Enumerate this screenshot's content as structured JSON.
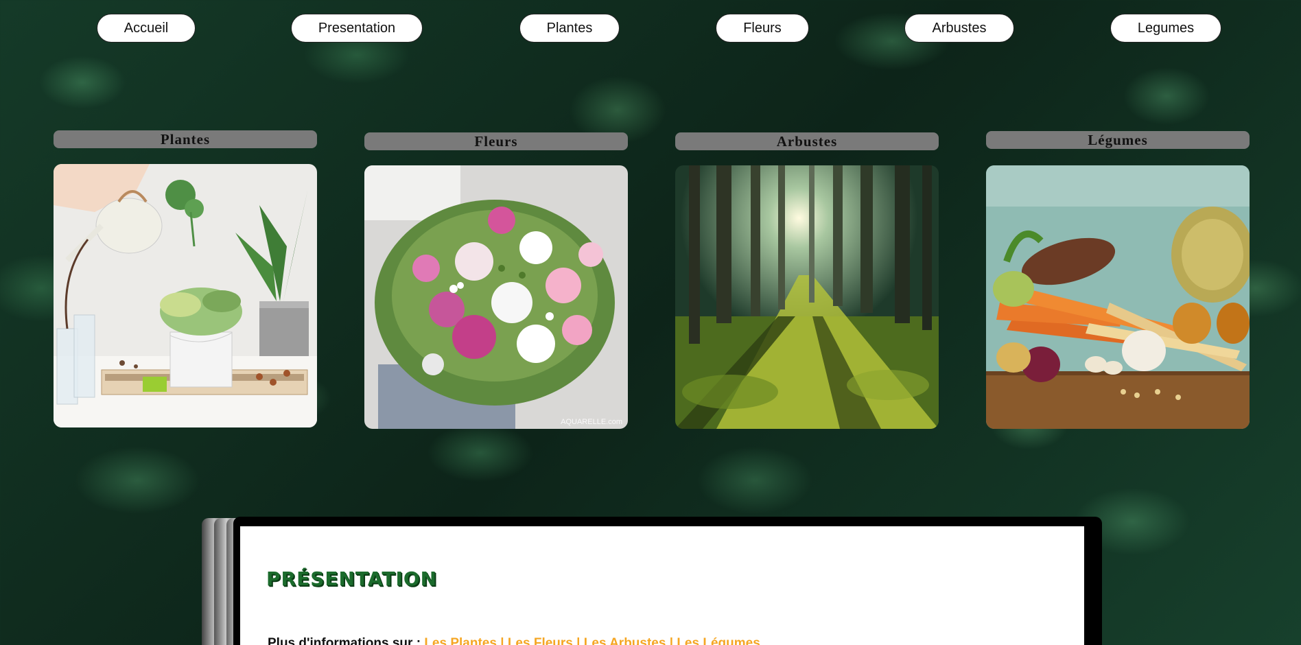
{
  "nav": {
    "items": [
      {
        "label": "Accueil"
      },
      {
        "label": "Presentation"
      },
      {
        "label": "Plantes"
      },
      {
        "label": "Fleurs"
      },
      {
        "label": "Arbustes"
      },
      {
        "label": "Legumes"
      }
    ]
  },
  "cards": [
    {
      "title": "Plantes",
      "image": "houseplants-watering-photo"
    },
    {
      "title": "Fleurs",
      "image": "flower-bouquet-photo",
      "watermark": "AQUARELLE.com"
    },
    {
      "title": "Arbustes",
      "image": "sunlit-forest-photo"
    },
    {
      "title": "Légumes",
      "image": "vegetables-photo"
    }
  ],
  "presentation": {
    "title": "PRÉSENTATION",
    "info_prefix": "Plus d'informations sur :",
    "links": [
      {
        "label": "Les Plantes"
      },
      {
        "label": "Les Fleurs"
      },
      {
        "label": "Les Arbustes"
      },
      {
        "label": "Les Légumes"
      }
    ],
    "separator": "|"
  },
  "colors": {
    "title_green": "#1b6b2c",
    "link_orange": "#f5a623",
    "card_title_bg": "#7a7a7a"
  }
}
